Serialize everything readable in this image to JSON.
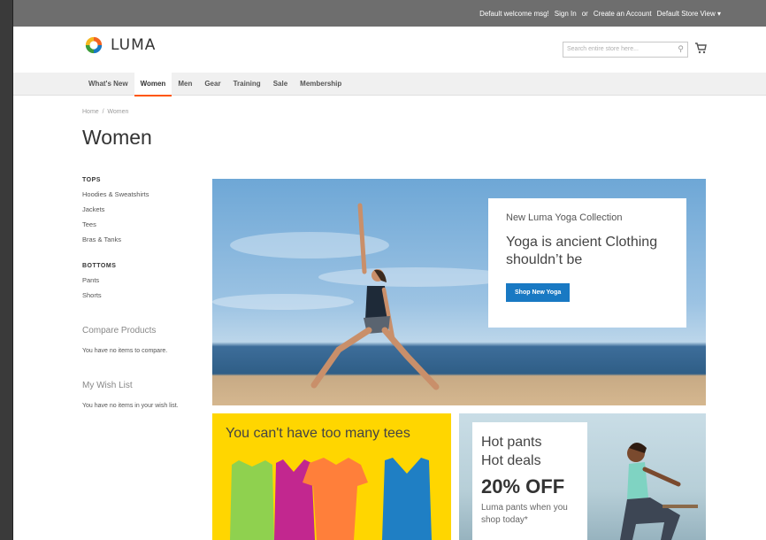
{
  "header": {
    "welcome": "Default welcome msg!",
    "sign_in": "Sign In",
    "or": "or",
    "create_account": "Create an Account",
    "store_view": "Default Store View ▾",
    "logo_text": "LUMA",
    "search_placeholder": "Search entire store here...",
    "search_icon": "search-icon",
    "cart_icon": "cart-icon"
  },
  "nav": {
    "items": [
      "What's New",
      "Women",
      "Men",
      "Gear",
      "Training",
      "Sale",
      "Membership"
    ],
    "active": "Women",
    "accent": "#ff5501"
  },
  "breadcrumb": {
    "home": "Home",
    "sep": "/",
    "current": "Women"
  },
  "page_title": "Women",
  "sidebar": {
    "tops_title": "TOPS",
    "tops": [
      "Hoodies & Sweatshirts",
      "Jackets",
      "Tees",
      "Bras & Tanks"
    ],
    "bottoms_title": "BOTTOMS",
    "bottoms": [
      "Pants",
      "Shorts"
    ],
    "compare_title": "Compare Products",
    "compare_text": "You have no items to compare.",
    "wishlist_title": "My Wish List",
    "wishlist_text": "You have no items in your wish list."
  },
  "hero": {
    "subtitle": "New Luma Yoga Collection",
    "headline": "Yoga is ancient Clothing shouldn’t be",
    "button": "Shop New Yoga",
    "button_color": "#1979c3"
  },
  "promo_tees": {
    "text": "You can't have too many tees",
    "bg": "#ffd600"
  },
  "promo_pants": {
    "line1": "Hot pants",
    "line2": "Hot deals",
    "discount": "20% OFF",
    "small": "Luma pants when you shop today*"
  }
}
